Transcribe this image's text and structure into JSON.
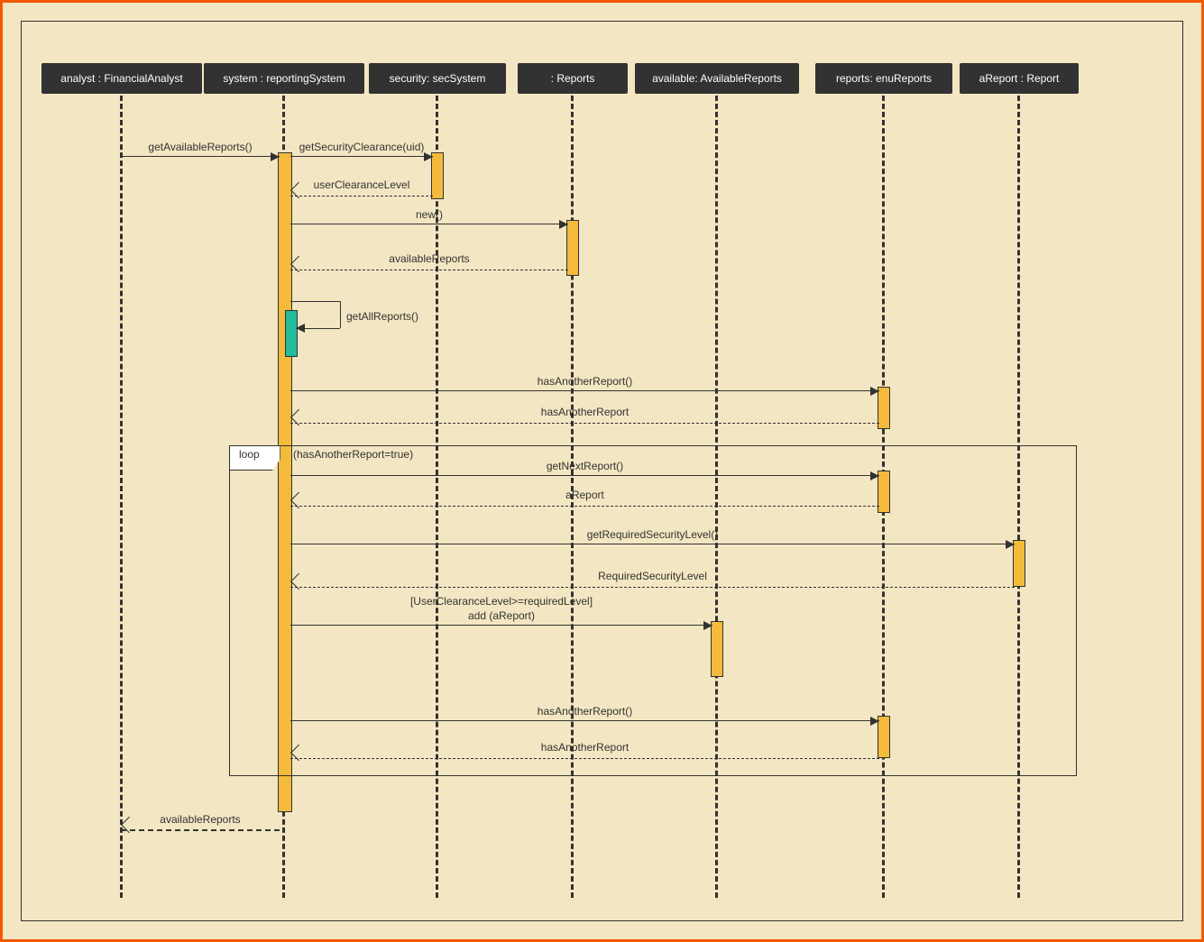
{
  "lifelines": {
    "analyst": "analyst : FinancialAnalyst",
    "system": "system : reportingSystem",
    "security": "security: secSystem",
    "reports": ": Reports",
    "available": "available: AvailableReports",
    "enu": "reports: enuReports",
    "aReport": "aReport : Report"
  },
  "messages": {
    "m1": "getAvailableReports()",
    "m2": "getSecurityClearance(uid)",
    "m3": "userClearanceLevel",
    "m4": "new()",
    "m5": "availableReports",
    "m6": "getAllReports()",
    "m7": "hasAnotherReport()",
    "m8": "hasAnotherReport",
    "m9": "getNextReport()",
    "m10": "aReport",
    "m11": "getRequiredSecurityLevel()",
    "m12": "RequiredSecurityLevel",
    "m13a": "[UserClearanceLevel>=requiredLevel]",
    "m13b": "add (aReport)",
    "m14": "hasAnotherReport()",
    "m15": "hasAnotherReport",
    "m16": "availableReports"
  },
  "loop": {
    "label": "loop",
    "cond": "(hasAnotherReport=true)"
  }
}
